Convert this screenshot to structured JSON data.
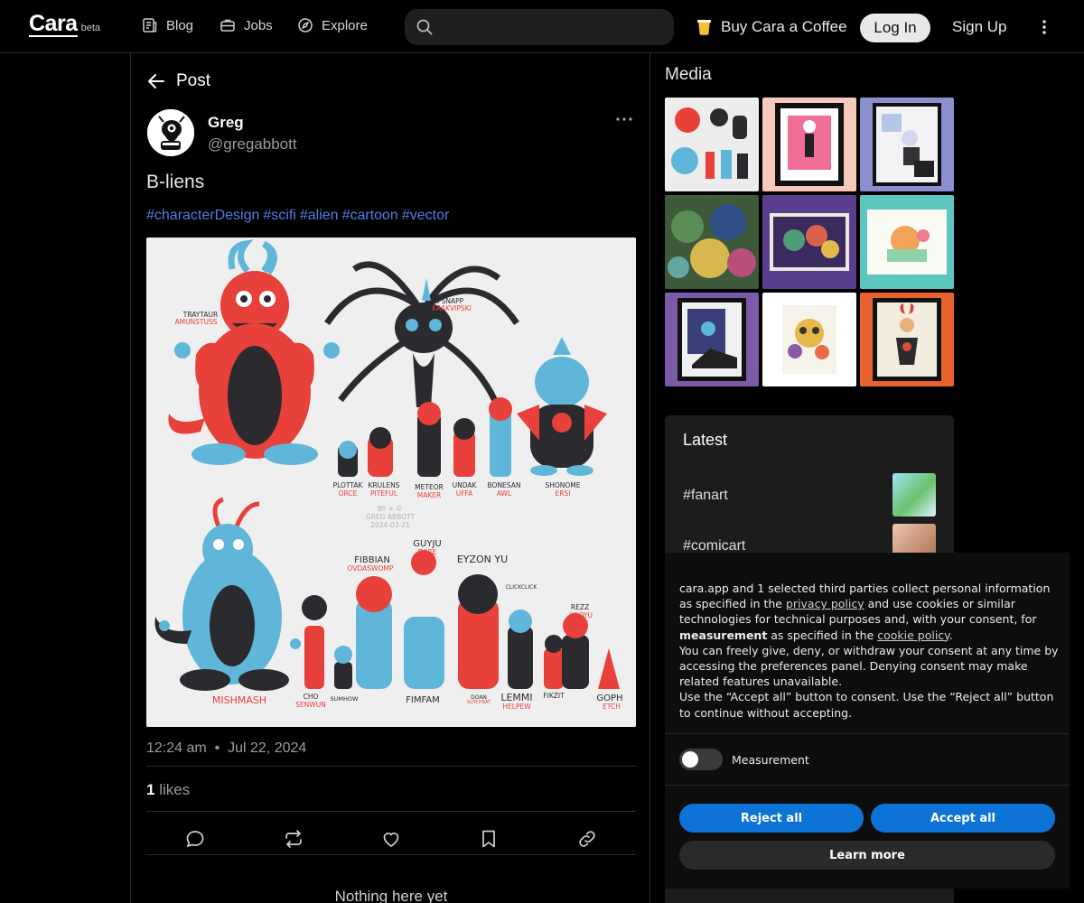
{
  "header": {
    "logo": "Cara",
    "logo_badge": "beta",
    "nav": [
      {
        "label": "Blog",
        "icon": "blog-icon"
      },
      {
        "label": "Jobs",
        "icon": "briefcase-icon"
      },
      {
        "label": "Explore",
        "icon": "compass-icon"
      }
    ],
    "search_placeholder": "",
    "coffee_label": "Buy Cara a Coffee",
    "login_label": "Log In",
    "signup_label": "Sign Up"
  },
  "post": {
    "back_label": "Post",
    "author_name": "Greg",
    "author_handle": "@gregabbott",
    "title": "B-liens",
    "tags": [
      "#characterDesign",
      "#scifi",
      "#alien",
      "#cartoon",
      "#vector"
    ],
    "time": "12:24 am",
    "date": "Jul 22, 2024",
    "likes_count": "1",
    "likes_label": "likes",
    "empty_label": "Nothing here yet"
  },
  "artwork": {
    "labels_top": [
      {
        "name": "TRAYTAUR",
        "sub": "AMUNSTUSS"
      },
      {
        "name": "VIPSNAPP",
        "sub": "KRAKVIPSKI"
      }
    ],
    "labels_row1": [
      {
        "name": "PLOTTAK",
        "sub": "ORCE"
      },
      {
        "name": "KRULENS",
        "sub": "PITEFUL"
      },
      {
        "name": "METEOR",
        "sub": "MAKER"
      },
      {
        "name": "UNDAK",
        "sub": "UFFA"
      },
      {
        "name": "BONESAN",
        "sub": "AWL"
      },
      {
        "name": "SHONOME",
        "sub": "ERSI"
      }
    ],
    "signature": [
      "BY + ©",
      "GREG ABBOTT",
      "2024-03-21"
    ],
    "labels_row2_top": [
      {
        "name": "FIBBIAN",
        "sub": "OVDASWOMP"
      },
      {
        "name": "GUYJU",
        "sub": "DARE"
      },
      {
        "name": "EYZON YU",
        "sub": ""
      },
      {
        "name": "CLICKCLICK",
        "sub": ""
      },
      {
        "name": "REZZ",
        "sub": "KOOYU"
      }
    ],
    "labels_bottom": [
      {
        "name": "MISHMASH",
        "sub": ""
      },
      {
        "name": "CHO",
        "sub": "SENWUN"
      },
      {
        "name": "SUMHOW",
        "sub": ""
      },
      {
        "name": "FIMFAM",
        "sub": ""
      },
      {
        "name": "DOAN",
        "sub": "SUTCHSAT"
      },
      {
        "name": "LEMMI",
        "sub": "HELPEW"
      },
      {
        "name": "FIKZIT",
        "sub": ""
      },
      {
        "name": "GOPH",
        "sub": "ETCH"
      }
    ]
  },
  "sidebar": {
    "media_title": "Media",
    "latest_title": "Latest",
    "latest_items": [
      "#fanart",
      "#comicart"
    ]
  },
  "consent": {
    "p1_a": "cara.app and 1 selected third parties collect personal information as specified in the ",
    "privacy_link": "privacy policy",
    "p1_b": " and use cookies or similar technologies for technical purposes and, with your consent, for ",
    "measurement_bold": "measurement",
    "p1_c": " as specified in the ",
    "cookie_link": "cookie policy",
    "p1_d": ".",
    "p2": "You can freely give, deny, or withdraw your consent at any time by accessing the preferences panel. Denying consent may make related features unavailable.",
    "p3": "Use the “Accept all” button to consent. Use the “Reject all” button to continue without accepting.",
    "toggle_label": "Measurement",
    "reject_label": "Reject all",
    "accept_label": "Accept all",
    "learn_label": "Learn more"
  },
  "colors": {
    "hashtag": "#4f7fe6",
    "consent_button": "#0e73d6",
    "art_red": "#e8403a",
    "art_blue": "#5fb6d8",
    "art_dark": "#2b2a2e"
  }
}
